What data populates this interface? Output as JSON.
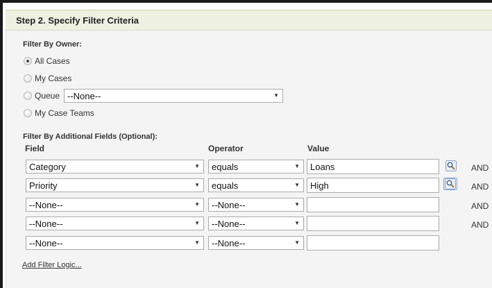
{
  "step_header": "Step 2. Specify Filter Criteria",
  "owner_filter": {
    "label": "Filter By Owner:",
    "options": [
      {
        "label": "All Cases",
        "checked": true
      },
      {
        "label": "My Cases",
        "checked": false
      },
      {
        "label": "Queue",
        "checked": false
      },
      {
        "label": "My Case Teams",
        "checked": false
      }
    ],
    "queue_select_value": "--None--"
  },
  "additional_filter": {
    "label": "Filter By Additional Fields (Optional):",
    "columns": {
      "field": "Field",
      "operator": "Operator",
      "value": "Value"
    },
    "rows": [
      {
        "field": "Category",
        "operator": "equals",
        "value": "Loans",
        "conjunction": "AND"
      },
      {
        "field": "Priority",
        "operator": "equals",
        "value": "High",
        "conjunction": "AND"
      },
      {
        "field": "--None--",
        "operator": "--None--",
        "value": "",
        "conjunction": "AND"
      },
      {
        "field": "--None--",
        "operator": "--None--",
        "value": "",
        "conjunction": "AND"
      },
      {
        "field": "--None--",
        "operator": "--None--",
        "value": "",
        "conjunction": ""
      }
    ],
    "lookup_icon": "magnifier-lookup-icon",
    "dropdown_icon": "dropdown-arrow-icon",
    "dropdown_glyph": "▼"
  },
  "add_filter_logic_link": "Add Filter Logic..."
}
